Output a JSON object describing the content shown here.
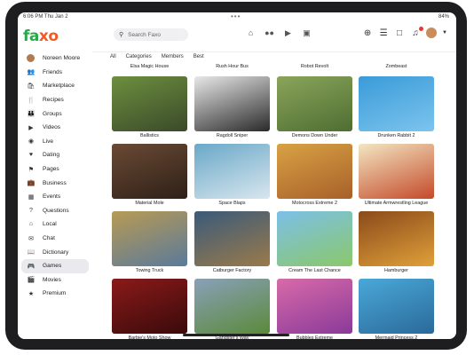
{
  "status": {
    "time": "6:06 PM  Thu Jan 2",
    "dots": "•••",
    "right": "84%"
  },
  "header": {
    "logo": "fa",
    "logo_x": "xo",
    "search_placeholder": "Search Faxo",
    "nav_icons": [
      "home-icon",
      "people-icon",
      "video-icon",
      "store-icon"
    ],
    "right_icons": [
      "plus-icon",
      "menu-icon",
      "chat-icon",
      "bell-icon"
    ]
  },
  "sidebar": {
    "items": [
      {
        "label": "Noreen Moore",
        "icon": "avatar"
      },
      {
        "label": "Friends",
        "icon": "👥"
      },
      {
        "label": "Marketplace",
        "icon": "🛍"
      },
      {
        "label": "Recipes",
        "icon": "🍴"
      },
      {
        "label": "Groups",
        "icon": "👪"
      },
      {
        "label": "Videos",
        "icon": "▶"
      },
      {
        "label": "Live",
        "icon": "◉"
      },
      {
        "label": "Dating",
        "icon": "♥"
      },
      {
        "label": "Pages",
        "icon": "⚑"
      },
      {
        "label": "Business",
        "icon": "💼"
      },
      {
        "label": "Events",
        "icon": "▦"
      },
      {
        "label": "Questions",
        "icon": "?"
      },
      {
        "label": "Local",
        "icon": "⌂"
      },
      {
        "label": "Chat",
        "icon": "✉"
      },
      {
        "label": "Dictionary",
        "icon": "📖"
      },
      {
        "label": "Games",
        "icon": "🎮"
      },
      {
        "label": "Movies",
        "icon": "🎬"
      },
      {
        "label": "Premium",
        "icon": "★"
      }
    ]
  },
  "tabs": [
    "All",
    "Categories",
    "Members",
    "Best"
  ],
  "top_captions": [
    "Elsa Magic House",
    "Rush Hour Bus",
    "Robot Revolt",
    "Zombeast"
  ],
  "games": [
    {
      "title": "Ballistics",
      "c1": "#6d8f3e",
      "c2": "#3a4a2a"
    },
    {
      "title": "Ragdoll Sniper",
      "c1": "#e8e8e8",
      "c2": "#2a2a2a"
    },
    {
      "title": "Demons Down Under",
      "c1": "#8aa45a",
      "c2": "#4e6e32"
    },
    {
      "title": "Drunken Rabbit 2",
      "c1": "#3a9bd8",
      "c2": "#7cc4ee"
    },
    {
      "title": "Material Mole",
      "c1": "#6a4a34",
      "c2": "#2e2018"
    },
    {
      "title": "Space Blaps",
      "c1": "#6aa8c8",
      "c2": "#d8e6ee"
    },
    {
      "title": "Motocross Extreme 2",
      "c1": "#d8a244",
      "c2": "#a8602a"
    },
    {
      "title": "Ultimate Armwrestling League",
      "c1": "#f3e6c2",
      "c2": "#c44a2a"
    },
    {
      "title": "Towing Truck",
      "c1": "#b89a54",
      "c2": "#5a7a9a"
    },
    {
      "title": "Catburger Factory",
      "c1": "#3a5a7a",
      "c2": "#9a7a4a"
    },
    {
      "title": "Cream The Last Chance",
      "c1": "#7cc0e8",
      "c2": "#8ac86a"
    },
    {
      "title": "Hamburger",
      "c1": "#8a4a1a",
      "c2": "#e0a03a"
    },
    {
      "title": "Barbie's Moto Show",
      "c1": "#8a1a1a",
      "c2": "#3a0a0a"
    },
    {
      "title": "Gangster's Way",
      "c1": "#8aa0b8",
      "c2": "#5a8a3a"
    },
    {
      "title": "Bubbles Extreme",
      "c1": "#d86aa8",
      "c2": "#8a3a9a"
    },
    {
      "title": "Mermaid Princess 2",
      "c1": "#4aa8d8",
      "c2": "#2a6a9a"
    }
  ]
}
